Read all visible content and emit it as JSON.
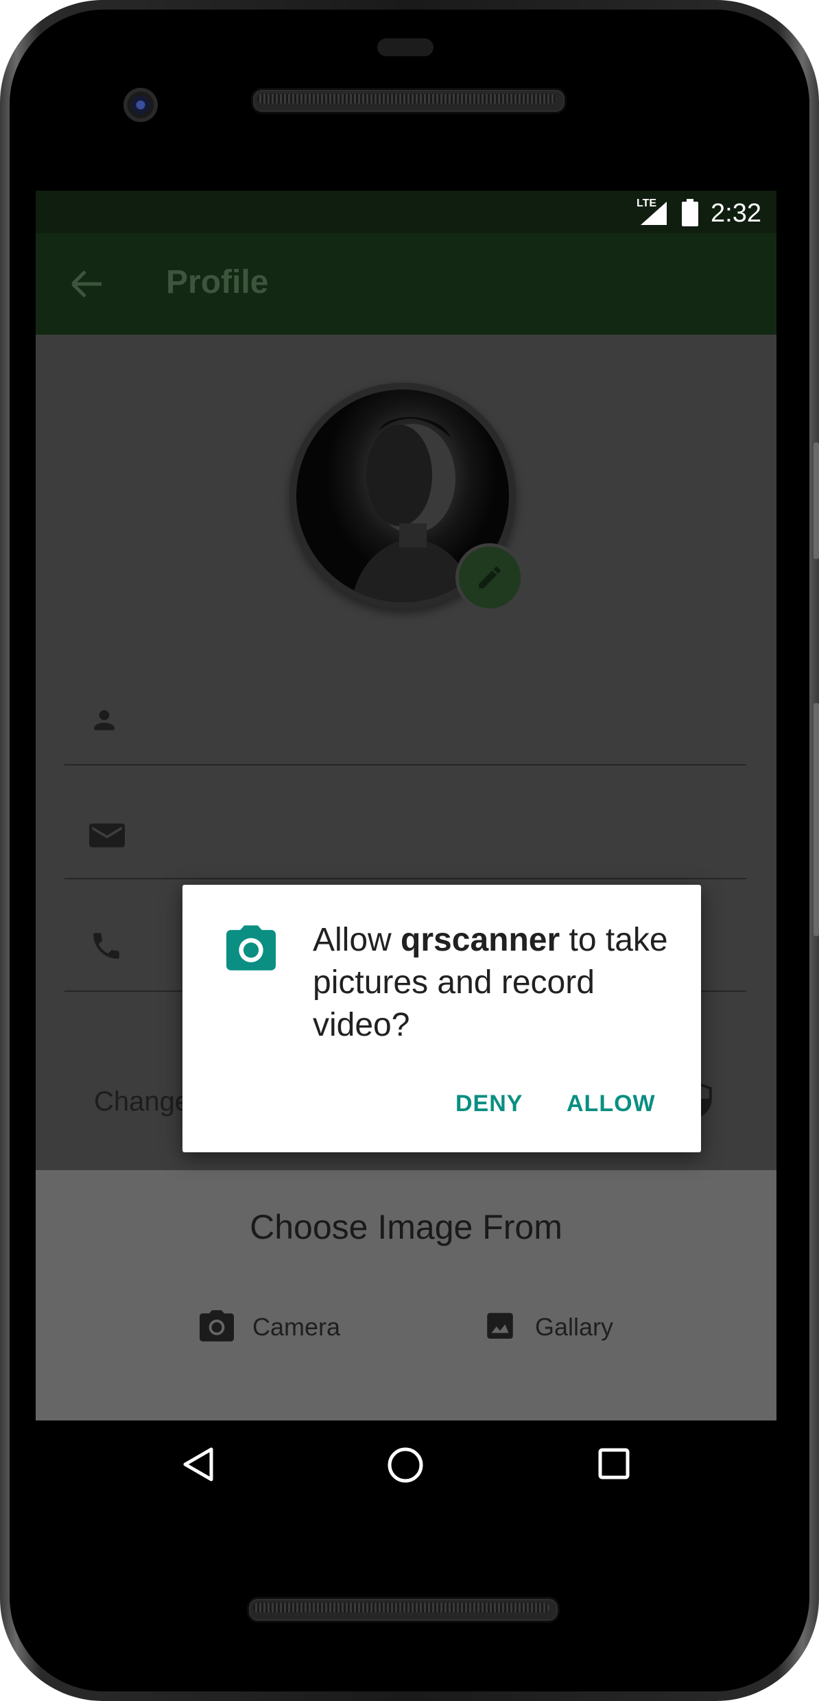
{
  "status_bar": {
    "network": "LTE",
    "time": "2:32"
  },
  "app_bar": {
    "title": "Profile",
    "back_icon": "arrow-back-icon"
  },
  "profile_form": {
    "fields": [
      {
        "icon": "person-icon"
      },
      {
        "icon": "email-icon"
      },
      {
        "icon": "phone-icon"
      }
    ],
    "change_password_label": "Change Password",
    "change_password_icon": "shield-icon"
  },
  "bottom_sheet": {
    "title": "Choose Image From",
    "options": [
      {
        "label": "Camera",
        "icon": "camera-icon"
      },
      {
        "label": "Gallary",
        "icon": "image-icon"
      }
    ]
  },
  "permission_dialog": {
    "icon": "camera-icon",
    "text_before": "Allow ",
    "app_name": "qrscanner",
    "text_after": " to take pictures and record video?",
    "deny_label": "DENY",
    "allow_label": "ALLOW",
    "accent_color": "#0a8f82"
  },
  "nav_bar": {
    "back": "nav-back-icon",
    "home": "nav-home-icon",
    "recents": "nav-recents-icon"
  }
}
